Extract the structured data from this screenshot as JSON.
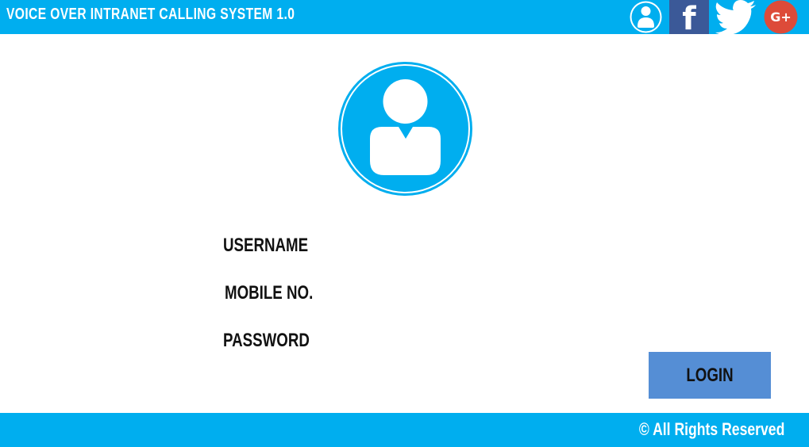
{
  "header": {
    "title": "VOICE  OVER  INTRANET  CALLING  SYSTEM 1.0",
    "icons": [
      "user-icon",
      "facebook-icon",
      "twitter-icon",
      "google-plus-icon"
    ],
    "facebook_glyph": "f",
    "google_plus_glyph": "G+"
  },
  "colors": {
    "brand": "#00aeef",
    "facebook": "#3b5998",
    "google_plus": "#dd4b39",
    "login_button": "#558ed5"
  },
  "form": {
    "avatar_icon": "user-avatar-icon",
    "username_label": "USERNAME",
    "mobile_label": "MOBILE NO.",
    "password_label": "PASSWORD",
    "login_label": "LOGIN"
  },
  "footer": {
    "text": "© All Rights Reserved"
  }
}
